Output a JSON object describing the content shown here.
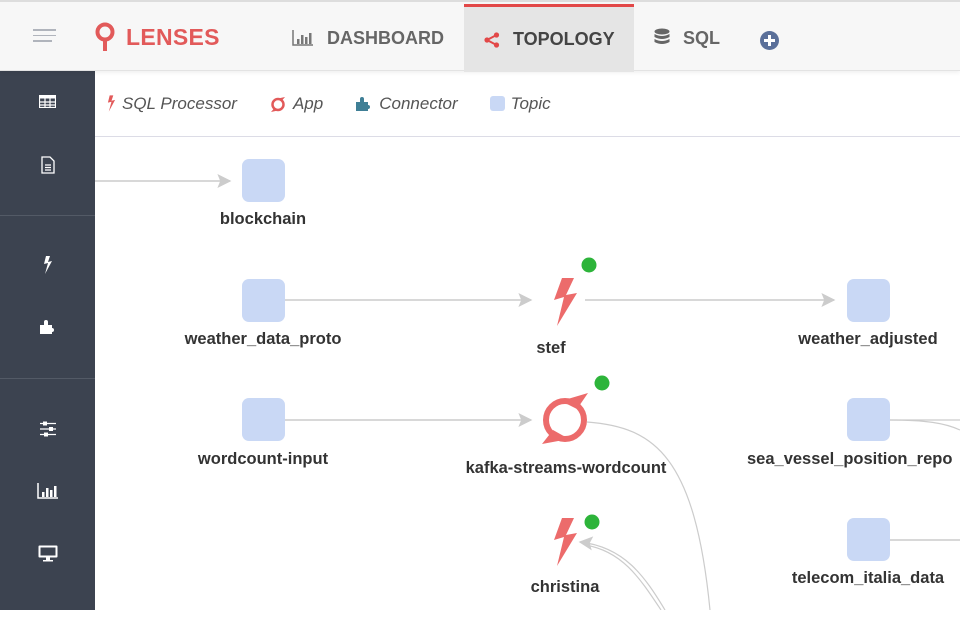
{
  "header": {
    "brand": "LENSES",
    "tabs": [
      {
        "label": "DASHBOARD",
        "icon": "bar-chart-icon",
        "active": false
      },
      {
        "label": "TOPOLOGY",
        "icon": "share-icon",
        "active": true
      },
      {
        "label": "SQL",
        "icon": "database-icon",
        "active": false
      }
    ],
    "add_icon": "plus-circle-icon"
  },
  "sidebar": {
    "items": [
      {
        "icon": "table-icon"
      },
      {
        "icon": "document-icon"
      },
      {
        "icon": "bolt-icon"
      },
      {
        "icon": "puzzle-icon"
      },
      {
        "icon": "sliders-icon"
      },
      {
        "icon": "bar-chart-icon"
      },
      {
        "icon": "monitor-icon"
      }
    ]
  },
  "legend": {
    "items": [
      {
        "label": "SQL Processor",
        "icon": "bolt-icon"
      },
      {
        "label": "App",
        "icon": "app-ring-icon"
      },
      {
        "label": "Connector",
        "icon": "puzzle-icon"
      },
      {
        "label": "Topic",
        "icon": "square-icon"
      }
    ]
  },
  "colors": {
    "accent": "#e25a5a",
    "topic": "#c9d8f5",
    "status_running": "#2db43a",
    "edge": "#cccccc",
    "sidebar": "#3c4350"
  },
  "topology": {
    "nodes": [
      {
        "id": "blockchain",
        "label": "blockchain",
        "type": "topic"
      },
      {
        "id": "weather_data_proto",
        "label": "weather_data_proto",
        "type": "topic"
      },
      {
        "id": "stef",
        "label": "stef",
        "type": "processor",
        "status": "running"
      },
      {
        "id": "weather_adjusted",
        "label": "weather_adjusted",
        "type": "topic"
      },
      {
        "id": "wordcount-input",
        "label": "wordcount-input",
        "type": "topic"
      },
      {
        "id": "kafka-streams-wordcount",
        "label": "kafka-streams-wordcount",
        "type": "app",
        "status": "running"
      },
      {
        "id": "sea_vessel_position_reports",
        "label": "sea_vessel_position_repo",
        "type": "topic"
      },
      {
        "id": "christina",
        "label": "christina",
        "type": "processor",
        "status": "running"
      },
      {
        "id": "telecom_italia_data",
        "label": "telecom_italia_data",
        "type": "topic"
      }
    ],
    "edges": [
      {
        "from": "offscreen",
        "to": "blockchain"
      },
      {
        "from": "weather_data_proto",
        "to": "stef"
      },
      {
        "from": "stef",
        "to": "weather_adjusted"
      },
      {
        "from": "wordcount-input",
        "to": "kafka-streams-wordcount"
      },
      {
        "from": "kafka-streams-wordcount",
        "to": "offscreen"
      },
      {
        "from": "offscreen",
        "to": "christina"
      },
      {
        "from": "sea_vessel_position_reports",
        "to": "offscreen"
      },
      {
        "from": "telecom_italia_data",
        "to": "offscreen"
      }
    ]
  }
}
